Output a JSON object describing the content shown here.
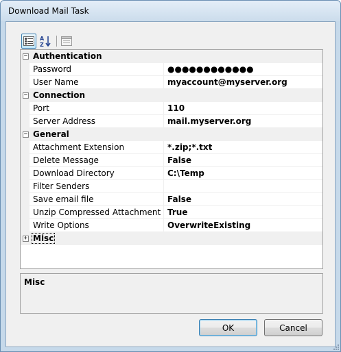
{
  "window": {
    "title": "Download Mail Task"
  },
  "toolbar": {
    "categorized_icon": "categorized-icon",
    "alphabetical_icon": "alphabetical-icon",
    "property_pages_icon": "property-pages-icon"
  },
  "grid": {
    "categories": [
      {
        "name": "Authentication",
        "expanded": true,
        "properties": [
          {
            "name": "Password",
            "value": "●●●●●●●●●●●●"
          },
          {
            "name": "User Name",
            "value": "myaccount@myserver.org"
          }
        ]
      },
      {
        "name": "Connection",
        "expanded": true,
        "properties": [
          {
            "name": "Port",
            "value": "110"
          },
          {
            "name": "Server Address",
            "value": "mail.myserver.org"
          }
        ]
      },
      {
        "name": "General",
        "expanded": true,
        "properties": [
          {
            "name": "Attachment Extension",
            "value": "*.zip;*.txt"
          },
          {
            "name": "Delete Message",
            "value": "False"
          },
          {
            "name": "Download Directory",
            "value": "C:\\Temp"
          },
          {
            "name": "Filter Senders",
            "value": ""
          },
          {
            "name": "Save email file",
            "value": "False"
          },
          {
            "name": "Unzip Compressed Attachment",
            "value": "True"
          },
          {
            "name": "Write Options",
            "value": "OverwriteExisting"
          }
        ]
      },
      {
        "name": "Misc",
        "expanded": false,
        "properties": []
      }
    ],
    "expanded_glyph": "−",
    "collapsed_glyph": "+"
  },
  "help": {
    "title": "Misc"
  },
  "buttons": {
    "ok": "OK",
    "cancel": "Cancel"
  },
  "colors": {
    "category_bg": "#f0f0f0",
    "grid_line": "#f0f0f0",
    "accent": "#3c7fb1"
  }
}
